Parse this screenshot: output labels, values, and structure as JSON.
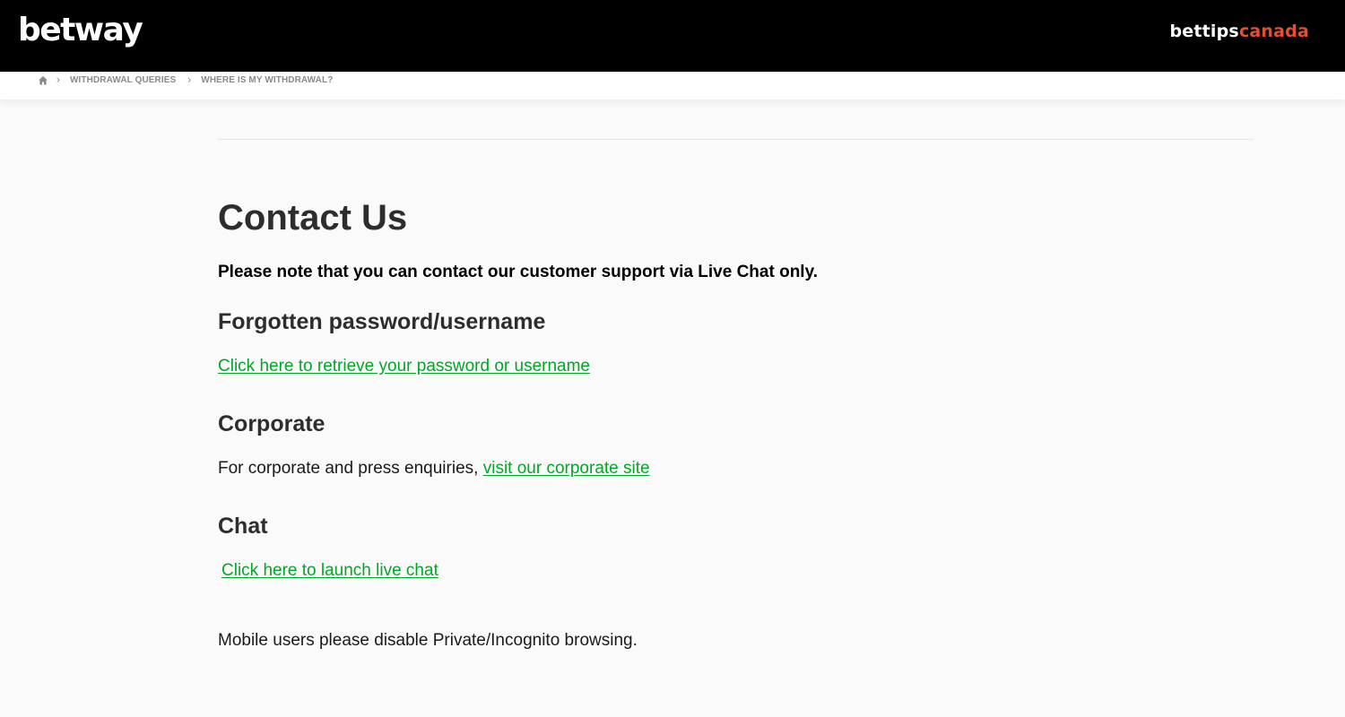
{
  "header": {
    "brand": "betway",
    "partner_part1": "bettips",
    "partner_part2": "canada",
    "colors": {
      "background": "#000000",
      "partner_accent": "#e4502f"
    }
  },
  "breadcrumb": {
    "home_icon": "home-icon",
    "separator_icon": "chevron-right-icon",
    "items": [
      "WITHDRAWAL QUERIES",
      "WHERE IS MY WITHDRAWAL?"
    ]
  },
  "main": {
    "title": "Contact Us",
    "notice": "Please note that you can contact our customer support via Live Chat only.",
    "sections": {
      "forgotten": {
        "heading": "Forgotten password/username",
        "link": "Click here to retrieve your password or username"
      },
      "corporate": {
        "heading": "Corporate",
        "text": "For corporate and press enquiries,",
        "link": "visit our corporate site"
      },
      "chat": {
        "heading": "Chat",
        "link": "Click here to launch live chat"
      }
    },
    "mobile_note": "Mobile users please disable Private/Incognito browsing.",
    "link_color": "#00a826"
  }
}
